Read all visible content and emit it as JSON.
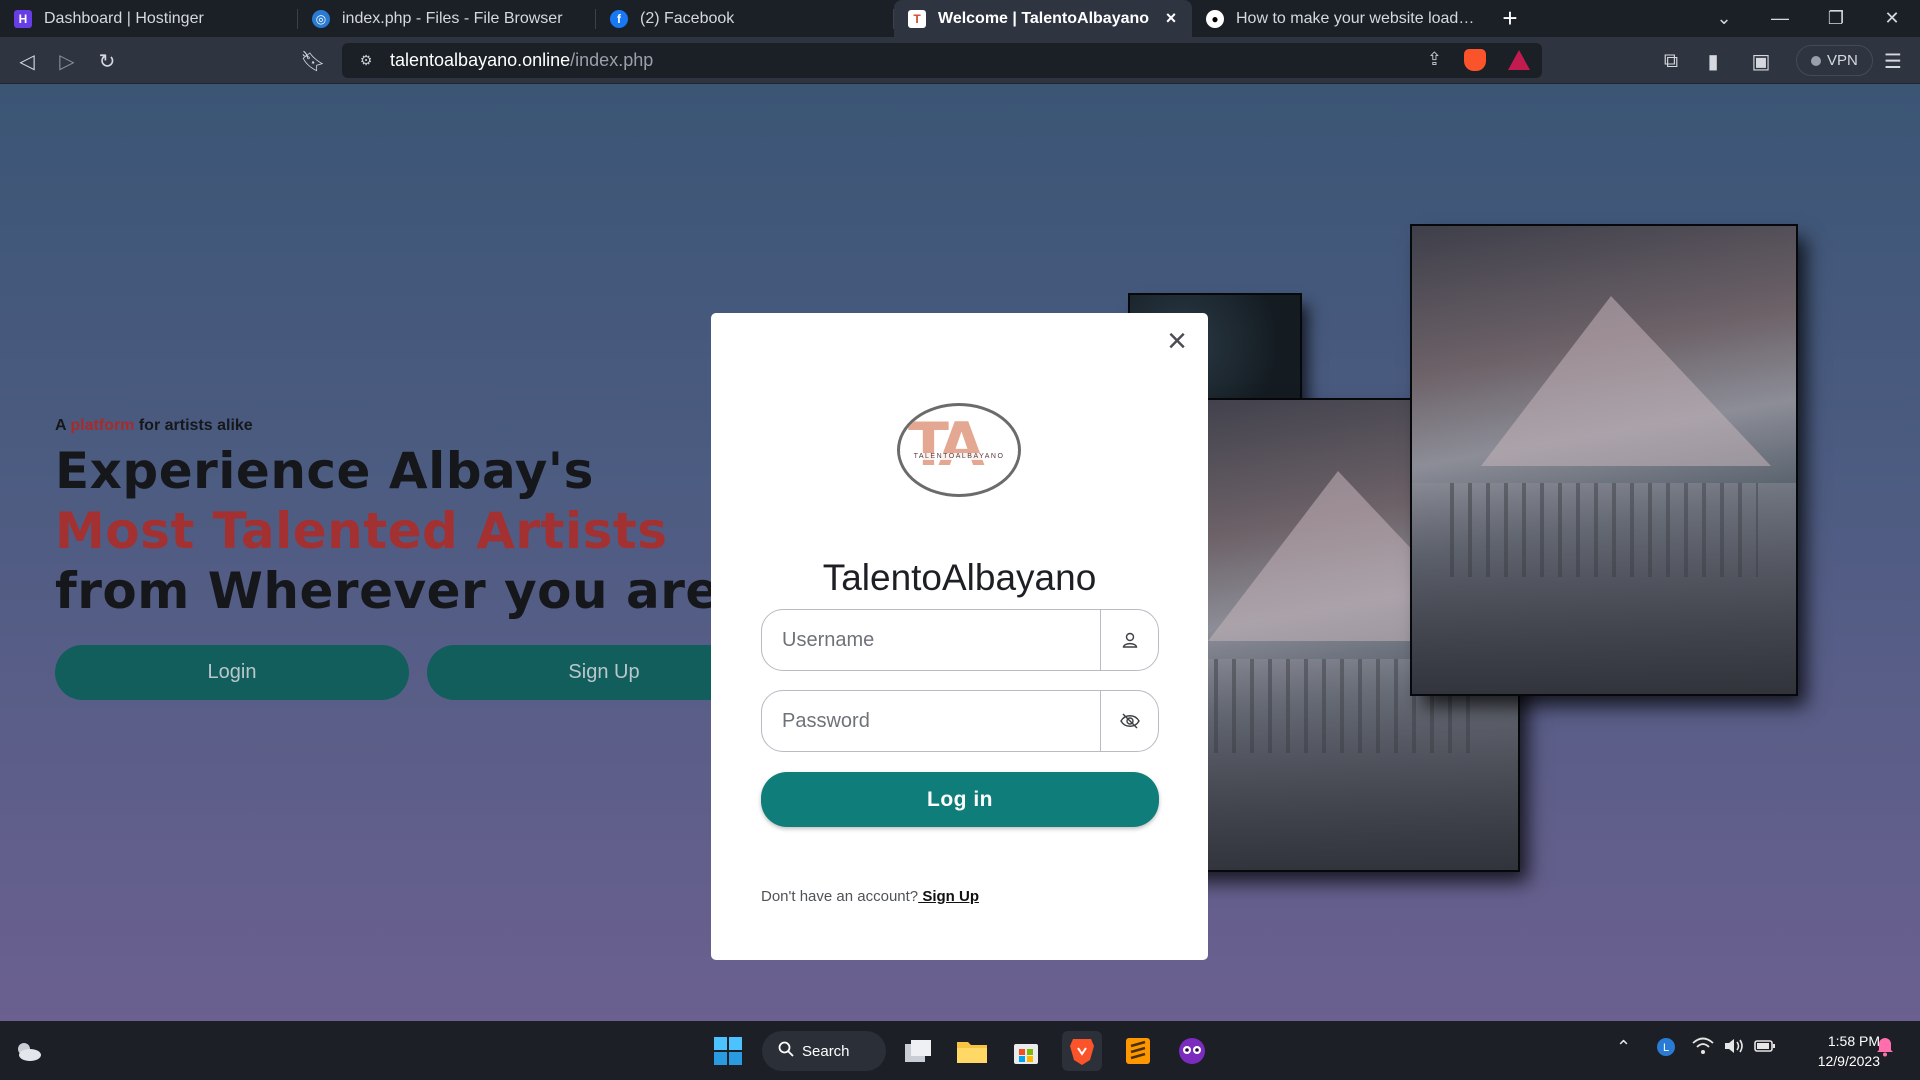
{
  "browser": {
    "tabs": [
      {
        "title": "Dashboard | Hostinger",
        "favicon": "hostinger-icon",
        "favicon_color": "#673de6",
        "active": false
      },
      {
        "title": "index.php - Files - File Browser",
        "favicon": "globe-icon",
        "favicon_color": "#2a7bd3",
        "active": false
      },
      {
        "title": "(2) Facebook",
        "favicon": "facebook-icon",
        "favicon_color": "#1877f2",
        "active": false
      },
      {
        "title": "Welcome | TalentoAlbayano",
        "favicon": "talento-icon",
        "favicon_color": "#ffffff",
        "active": true
      },
      {
        "title": "How to make your website load faster",
        "favicon": "medium-icon",
        "favicon_color": "#ffffff",
        "active": false
      }
    ],
    "new_tab_label": "+",
    "address": {
      "domain": "talentoalbayano.online",
      "path": "/index.php"
    },
    "vpn_label": "VPN"
  },
  "page": {
    "tagline": {
      "prefix": "A ",
      "accent": "platform",
      "suffix": " for artists alike"
    },
    "headline": {
      "line1": "Experience Albay's",
      "line2": "Most Talented Artists",
      "line3": "from Wherever you are"
    },
    "buttons": {
      "login": "Login",
      "signup": "Sign Up"
    }
  },
  "modal": {
    "close_label": "×",
    "logo": {
      "monogram": "TA",
      "wordmark": "TALENTOALBAYANO"
    },
    "title": "TalentoAlbayano",
    "username_placeholder": "Username",
    "password_placeholder": "Password",
    "submit_label": "Log in",
    "signup_prompt": "Don't have an account?",
    "signup_link": " Sign Up"
  },
  "taskbar": {
    "search_label": "Search",
    "clock_time": "1:58 PM",
    "clock_date": "12/9/2023"
  },
  "colors": {
    "accent_teal": "#0f7d7a",
    "headline_red": "#a43131",
    "hero_button": "#115e5c"
  }
}
